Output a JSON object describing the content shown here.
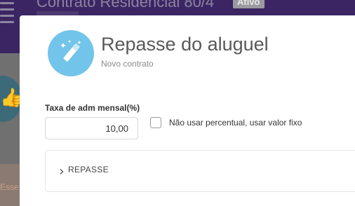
{
  "background": {
    "title": "Contrato Residencial 80/4",
    "badge": "Ativo",
    "panel_text": "Esse"
  },
  "modal": {
    "icon": "magic-wand-icon",
    "title": "Repasse do aluguel",
    "subtitle": "Novo contrato",
    "fields": {
      "rate_label": "Taxa de adm mensal(%)",
      "rate_value": "10,00",
      "fixed_value_label": "Não usar percentual, usar valor fixo",
      "fixed_value_checked": false
    },
    "sections": [
      {
        "title": "REPASSE",
        "icon": "chevron-right-icon",
        "expanded": false
      }
    ]
  },
  "colors": {
    "header_bg": "#3b2563",
    "icon_circle": "#72c4ea",
    "modal_bg": "#ffffff"
  }
}
